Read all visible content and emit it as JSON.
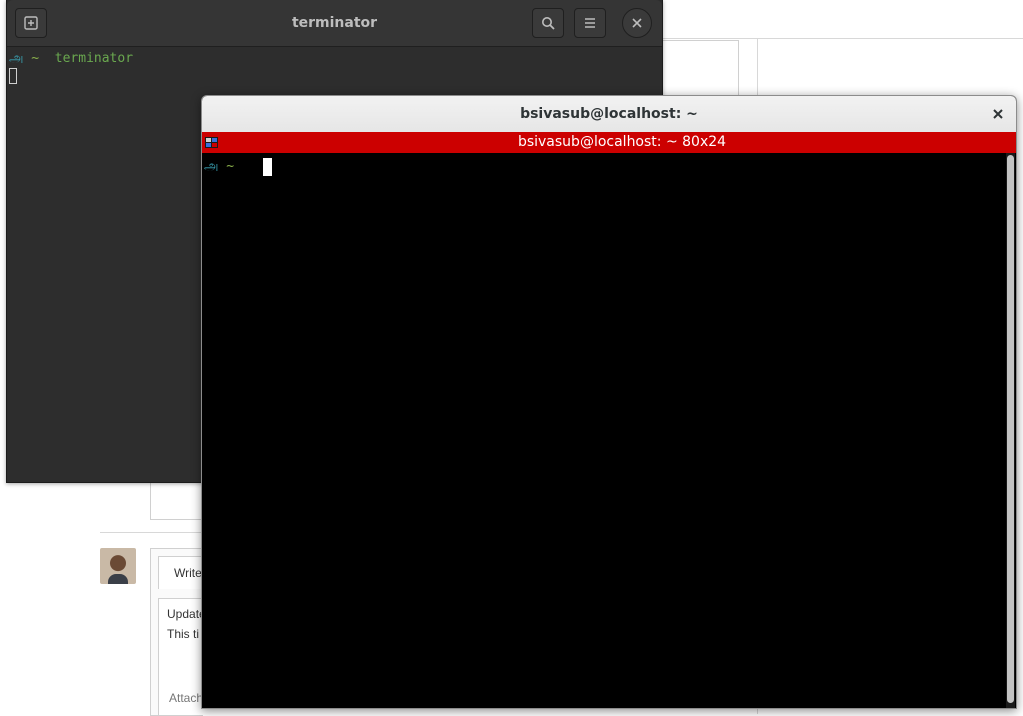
{
  "background_page": {
    "tab_label": "Write",
    "comment_line_1": "Update",
    "comment_line_2": "This ti",
    "attach_label": "Attach"
  },
  "terminator_window": {
    "title": "terminator",
    "new_tab_icon": "add-tab-icon",
    "search_icon": "search-icon",
    "menu_icon": "hamburger-menu-icon",
    "close_icon": "close-icon",
    "prompt_glyph": "அ",
    "prompt_dir": "~",
    "command": "terminator"
  },
  "terminal_window": {
    "title": "bsivasub@localhost: ~",
    "close_icon": "close-icon",
    "tab_title": "bsivasub@localhost: ~ 80x24",
    "tab_bar_color": "#cc0000",
    "prompt_glyph": "அ",
    "prompt_dir": "~"
  }
}
